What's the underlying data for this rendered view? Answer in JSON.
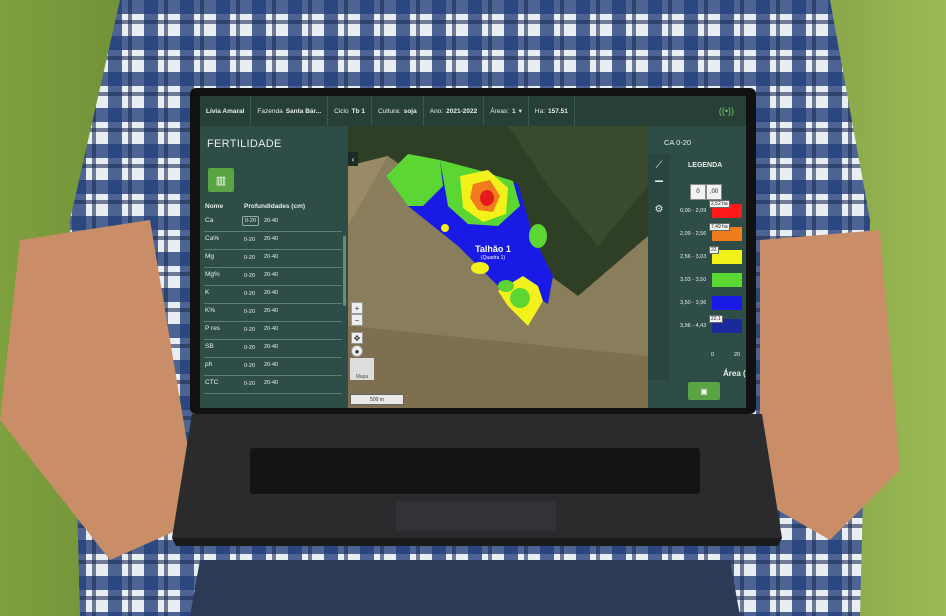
{
  "topbar": {
    "user": "Livia Amaral",
    "farm_label": "Fazenda",
    "farm_value": "Santa Bár...",
    "cycle_label": "Ciclo",
    "cycle_value": "Tb 1",
    "crop_label": "Cultura:",
    "crop_value": "soja",
    "year_label": "Ano:",
    "year_value": "2021-2022",
    "areas_label": "Áreas:",
    "areas_value": "1",
    "ha_label": "Ha:",
    "ha_value": "157.51",
    "wifi_icon": "wifi-icon"
  },
  "left_panel": {
    "title": "FERTILIDADE",
    "layers_icon": "layers-icon",
    "col_name": "Nome",
    "col_depths": "Profundidades (cm)",
    "rows": [
      {
        "name": "Ca",
        "d1": "0-20",
        "d2": "20-40"
      },
      {
        "name": "Ca%",
        "d1": "0-20",
        "d2": "20-40"
      },
      {
        "name": "Mg",
        "d1": "0-20",
        "d2": "20-40"
      },
      {
        "name": "Mg%",
        "d1": "0-20",
        "d2": "20-40"
      },
      {
        "name": "K",
        "d1": "0-20",
        "d2": "20-40"
      },
      {
        "name": "K%",
        "d1": "0-20",
        "d2": "20-40"
      },
      {
        "name": "P res",
        "d1": "0-20",
        "d2": "20-40"
      },
      {
        "name": "SB",
        "d1": "0-20",
        "d2": "20-40"
      },
      {
        "name": "ph",
        "d1": "0-20",
        "d2": "20-40"
      },
      {
        "name": "CTC",
        "d1": "0-20",
        "d2": "20-40"
      }
    ]
  },
  "map": {
    "field_name": "Talhão 1",
    "field_sub": "(Quadra 1)",
    "scale": "500 m",
    "thumb_label": "Mapa",
    "collapse_icon": "chevron-left-icon"
  },
  "right_panel": {
    "title": "CA 0-20",
    "legend_title": "LEGENDA",
    "input_a": "0",
    "input_b": ",00",
    "legend": [
      {
        "range": "0,00 - 2,09",
        "tag": "2,52 ha",
        "color": "#ff1a1a"
      },
      {
        "range": "2,09 - 2,56",
        "tag": "7,49 ha",
        "color": "#f07c1e"
      },
      {
        "range": "2,56 - 3,03",
        "tag": "22",
        "color": "#f2f21a"
      },
      {
        "range": "3,03 - 3,50",
        "tag": "",
        "color": "#5cd633"
      },
      {
        "range": "3,50 - 3,96",
        "tag": "",
        "color": "#1a1ae6"
      },
      {
        "range": "3,96 - 4,43",
        "tag": "22,1",
        "color": "#1a2a9a"
      }
    ],
    "axis_0": "0",
    "axis_20": "20",
    "area_label": "Área (",
    "chart_icon": "line-chart-icon",
    "paint_icon": "paint-roller-icon",
    "settings_icon": "gear-icon",
    "save_icon": "save-icon"
  }
}
